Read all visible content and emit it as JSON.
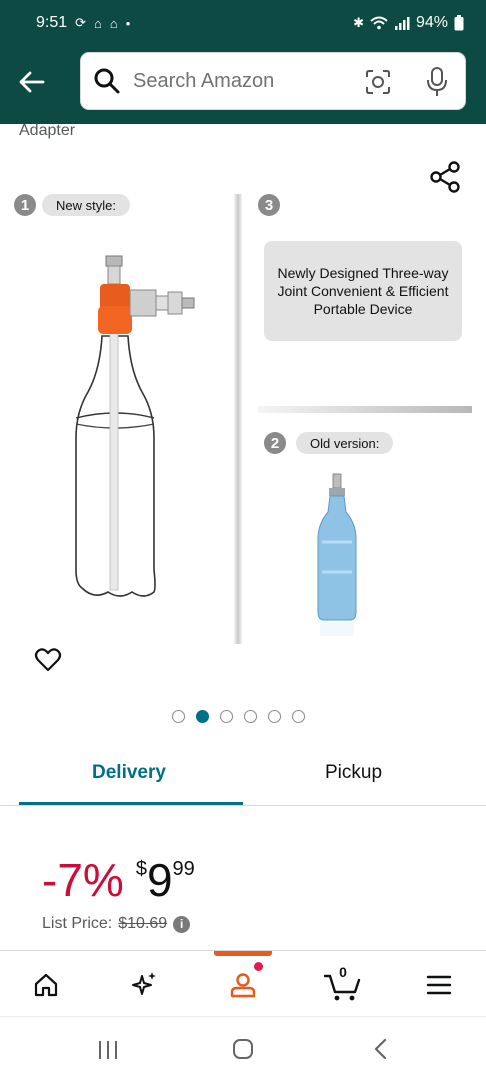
{
  "status": {
    "time": "9:51",
    "battery": "94%"
  },
  "search": {
    "placeholder": "Search Amazon"
  },
  "product": {
    "title_fragment": "Adapter"
  },
  "gallery": {
    "label_new": "New style:",
    "label_old": "Old version:",
    "num1": "1",
    "num2": "2",
    "num3": "3",
    "callout": "Newly Designed Three-way Joint Convenient & Efficient Portable Device",
    "dot_count": 6,
    "active_dot": 2
  },
  "tabs": {
    "delivery": "Delivery",
    "pickup": "Pickup"
  },
  "price": {
    "discount": "-7%",
    "currency": "$",
    "whole": "9",
    "fraction": "99",
    "list_label": "List Price:",
    "list_value": "$10.69"
  },
  "nav": {
    "cart_count": "0",
    "active": "account"
  },
  "colors": {
    "header": "#0d4a44",
    "accent_teal": "#007185",
    "discount_red": "#cc0c39",
    "nav_active": "#e8591a"
  }
}
